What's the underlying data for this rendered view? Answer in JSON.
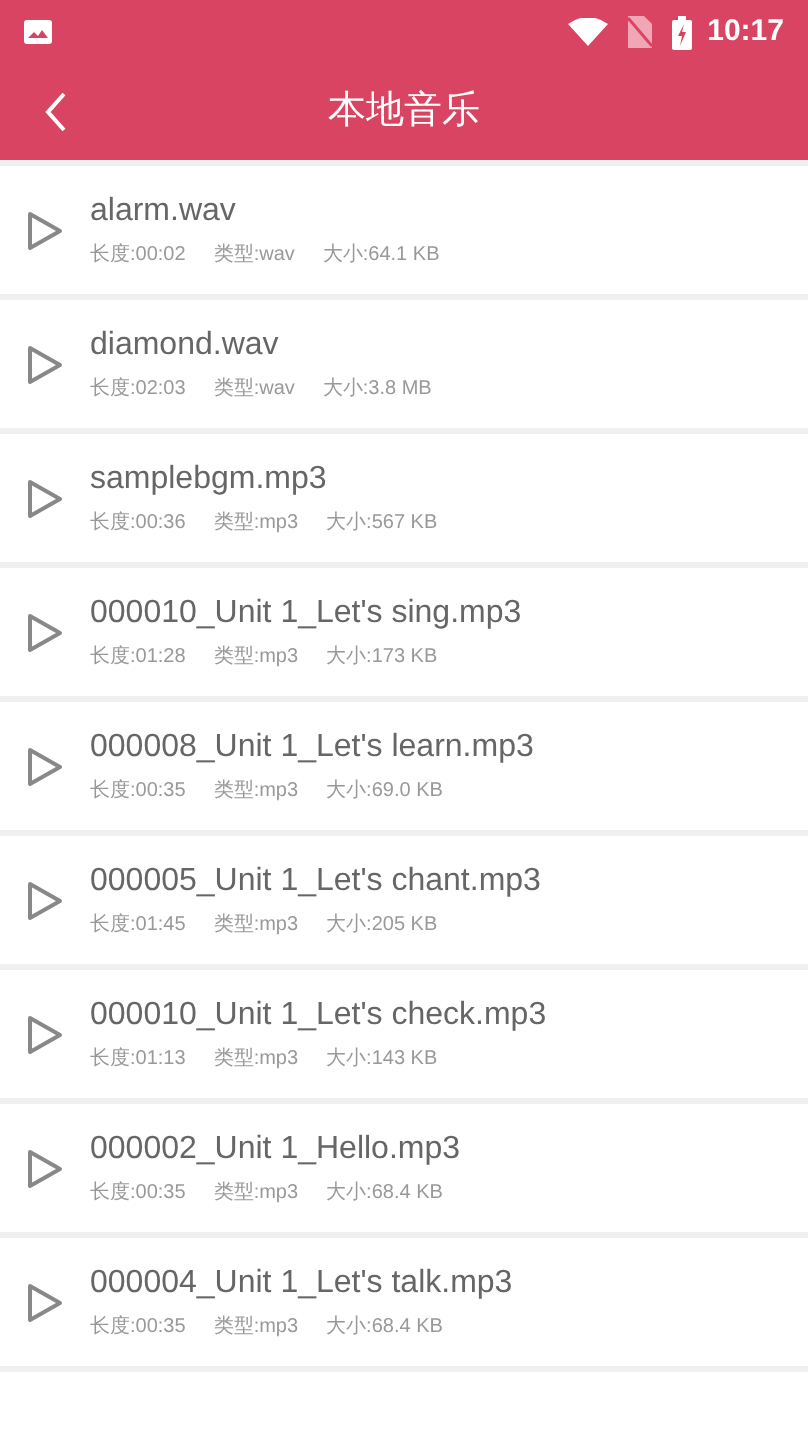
{
  "status_bar": {
    "time": "10:17"
  },
  "header": {
    "title": "本地音乐"
  },
  "tracks": [
    {
      "name": "alarm.wav",
      "duration": "长度:00:02",
      "type": "类型:wav",
      "size": "大小:64.1 KB"
    },
    {
      "name": "diamond.wav",
      "duration": "长度:02:03",
      "type": "类型:wav",
      "size": "大小:3.8 MB"
    },
    {
      "name": "samplebgm.mp3",
      "duration": "长度:00:36",
      "type": "类型:mp3",
      "size": "大小:567 KB"
    },
    {
      "name": "000010_Unit 1_Let's sing.mp3",
      "duration": "长度:01:28",
      "type": "类型:mp3",
      "size": "大小:173 KB"
    },
    {
      "name": "000008_Unit 1_Let's learn.mp3",
      "duration": "长度:00:35",
      "type": "类型:mp3",
      "size": "大小:69.0 KB"
    },
    {
      "name": "000005_Unit 1_Let's chant.mp3",
      "duration": "长度:01:45",
      "type": "类型:mp3",
      "size": "大小:205 KB"
    },
    {
      "name": "000010_Unit 1_Let's check.mp3",
      "duration": "长度:01:13",
      "type": "类型:mp3",
      "size": "大小:143 KB"
    },
    {
      "name": "000002_Unit 1_Hello.mp3",
      "duration": "长度:00:35",
      "type": "类型:mp3",
      "size": "大小:68.4 KB"
    },
    {
      "name": "000004_Unit 1_Let's talk.mp3",
      "duration": "长度:00:35",
      "type": "类型:mp3",
      "size": "大小:68.4 KB"
    }
  ]
}
